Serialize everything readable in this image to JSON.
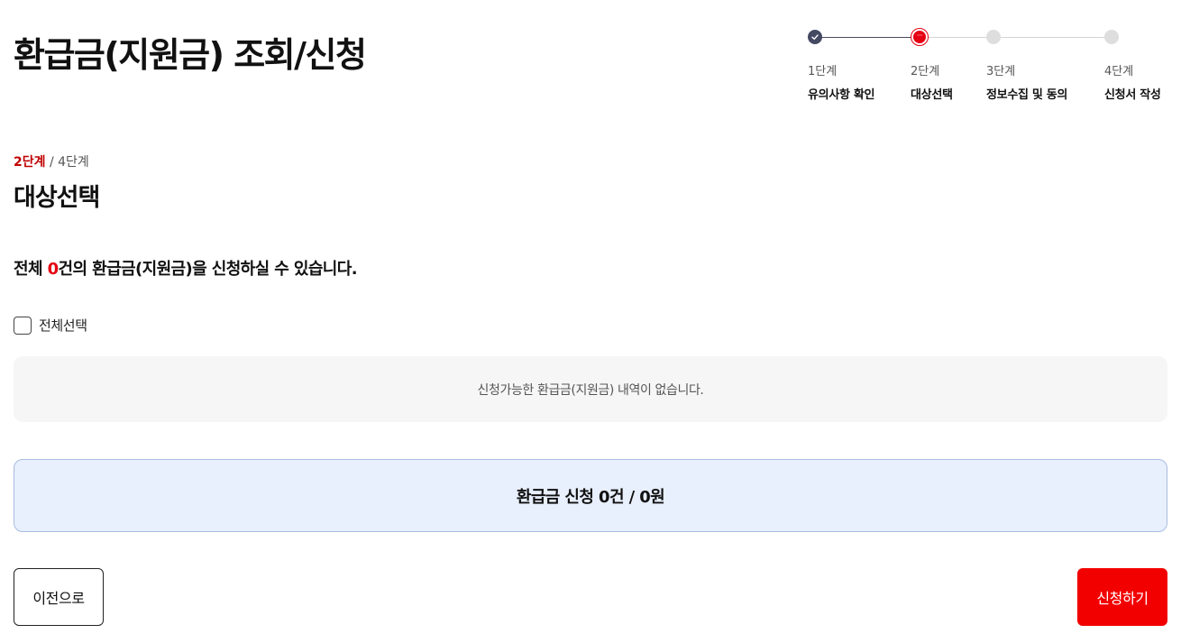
{
  "page": {
    "title": "환급금(지원금) 조회/신청"
  },
  "stepper": {
    "steps": [
      {
        "number": "1단계",
        "name": "유의사항 확인",
        "state": "done",
        "icon": "check-icon"
      },
      {
        "number": "2단계",
        "name": "대상선택",
        "state": "current",
        "icon": "ellipsis-icon"
      },
      {
        "number": "3단계",
        "name": "정보수집 및 동의",
        "state": "todo"
      },
      {
        "number": "4단계",
        "name": "신청서 작성",
        "state": "todo"
      }
    ],
    "current_glyph": "···"
  },
  "step_indicator": {
    "current": "2단계",
    "separator": " / ",
    "total": "4단계"
  },
  "section": {
    "title": "대상선택"
  },
  "summary": {
    "prefix": "전체 ",
    "count": "0",
    "suffix": "건의 환급금(지원금)을 신청하실 수 있습니다."
  },
  "select_all": {
    "label": "전체선택",
    "checked": false
  },
  "empty_message": "신청가능한 환급금(지원금) 내역이 없습니다.",
  "total": {
    "text": "환급금 신청 0건 / 0원"
  },
  "buttons": {
    "prev": "이전으로",
    "apply": "신청하기"
  },
  "colors": {
    "accent_red": "#e60012",
    "apply_button": "#f20000",
    "done_dot": "#454a63",
    "total_box_bg": "#e8effd",
    "empty_box_bg": "#f6f6f6"
  }
}
